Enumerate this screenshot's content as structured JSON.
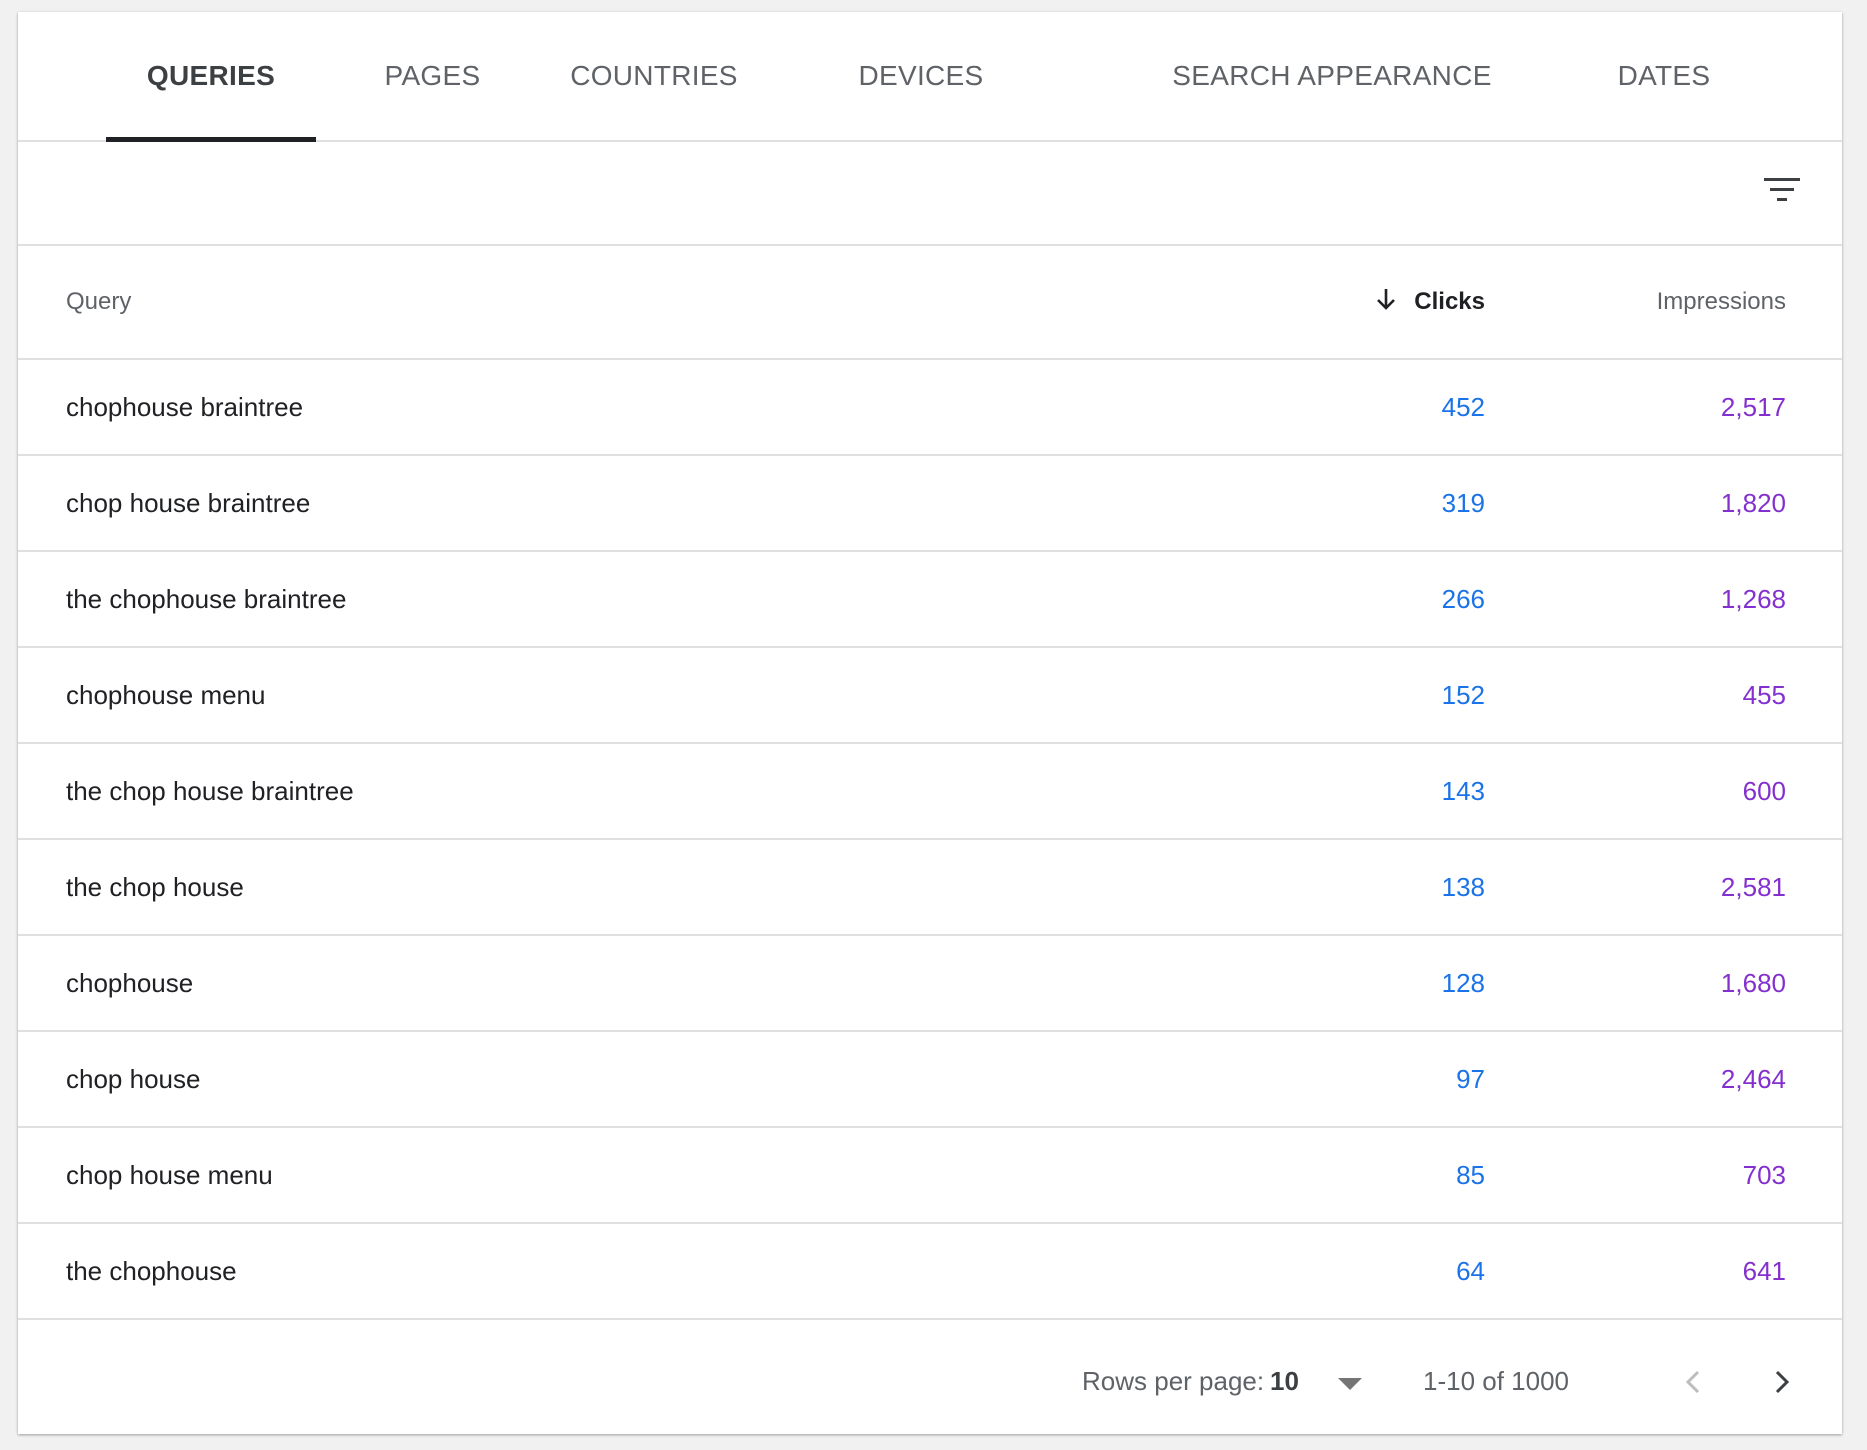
{
  "tabs": [
    {
      "label": "QUERIES",
      "active": true
    },
    {
      "label": "PAGES",
      "active": false
    },
    {
      "label": "COUNTRIES",
      "active": false
    },
    {
      "label": "DEVICES",
      "active": false
    },
    {
      "label": "SEARCH APPEARANCE",
      "active": false
    },
    {
      "label": "DATES",
      "active": false
    }
  ],
  "toolbar": {
    "filter_icon": "filter-icon"
  },
  "table": {
    "headers": {
      "query": "Query",
      "clicks": "Clicks",
      "impressions": "Impressions"
    },
    "sort": {
      "column": "clicks",
      "direction": "descending",
      "icon": "arrow-down-icon"
    },
    "rows": [
      {
        "query": "chophouse braintree",
        "clicks": "452",
        "impressions": "2,517"
      },
      {
        "query": "chop house braintree",
        "clicks": "319",
        "impressions": "1,820"
      },
      {
        "query": "the chophouse braintree",
        "clicks": "266",
        "impressions": "1,268"
      },
      {
        "query": "chophouse menu",
        "clicks": "152",
        "impressions": "455"
      },
      {
        "query": "the chop house braintree",
        "clicks": "143",
        "impressions": "600"
      },
      {
        "query": "the chop house",
        "clicks": "138",
        "impressions": "2,581"
      },
      {
        "query": "chophouse",
        "clicks": "128",
        "impressions": "1,680"
      },
      {
        "query": "chop house",
        "clicks": "97",
        "impressions": "2,464"
      },
      {
        "query": "chop house menu",
        "clicks": "85",
        "impressions": "703"
      },
      {
        "query": "the chophouse",
        "clicks": "64",
        "impressions": "641"
      }
    ]
  },
  "pagination": {
    "rows_per_page_label": "Rows per page:",
    "rows_per_page_value": "10",
    "range": "1-10 of 1000",
    "prev_icon": "chevron-left-icon",
    "next_icon": "chevron-right-icon"
  },
  "colors": {
    "clicks": "#1a73e8",
    "impressions": "#8430ce",
    "active_tab_indicator": "#202124"
  }
}
